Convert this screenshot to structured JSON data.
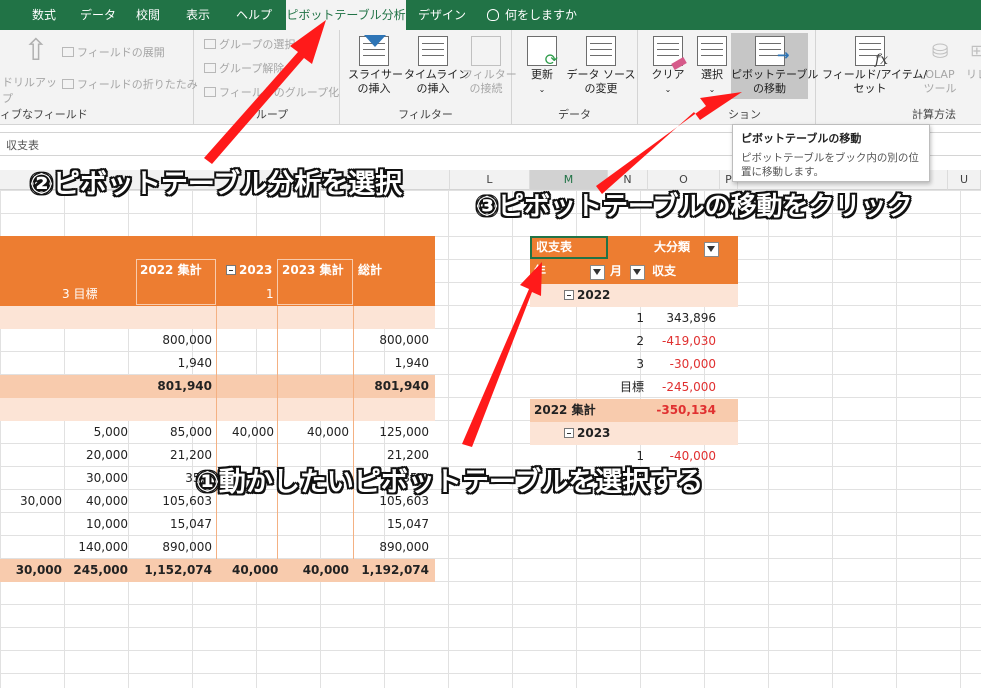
{
  "tabs": [
    "数式",
    "データ",
    "校閲",
    "表示",
    "ヘルプ",
    "ピボットテーブル分析",
    "デザイン",
    "何をしますか"
  ],
  "ribbon": {
    "group_field_label": "ィブなフィールド",
    "drillup_label": "ドリルアッ",
    "drillup_sub": "プ",
    "expand_label": "フィールドの展開",
    "collapse_label": "フィールドの折りたたみ",
    "group_sel": "グループの選択",
    "group_ungroup": "グループ解除",
    "group_field": "フィールドのグループ化",
    "group_label": "グループ",
    "slicer_label": "スライサー\nの挿入",
    "timeline_label": "タイムライン\nの挿入",
    "filter_conn_label": "フィルター\nの接続",
    "filter_group_label": "フィルター",
    "refresh_label": "更新",
    "change_source_label": "データ ソース\nの変更",
    "data_group_label": "データ",
    "clear_label": "クリア",
    "select_label": "選択",
    "move_label": "ピボットテーブル\nの移動",
    "action_group_label": "ション",
    "field_items_label": "フィールド/アイテム/\nセット",
    "olap_label": "OLAP\nツール",
    "rel_label": "リレ",
    "calc_group_label": "計算方法"
  },
  "formula_bar": {
    "value": "収支表"
  },
  "tooltip": {
    "title": "ピボットテーブルの移動",
    "body": "ピボットテーブルをブック内の別の位置に移動します。"
  },
  "columns": [
    "L",
    "M",
    "N",
    "O",
    "P",
    "U"
  ],
  "left_pivot": {
    "header_2022_total": "2022 集計",
    "header_2023": "2023",
    "header_2023_total": "2023 集計",
    "header_grand": "総計",
    "subhead_goal": "3 目標",
    "subhead_1": "1",
    "rows": [
      [
        "",
        "",
        "",
        "",
        "",
        "",
        ""
      ],
      [
        "",
        "",
        "800,000",
        "",
        "",
        "800,000"
      ],
      [
        "",
        "",
        "1,940",
        "",
        "",
        "1,940"
      ],
      [
        "",
        "",
        "801,940",
        "",
        "",
        "801,940"
      ],
      [
        "",
        "",
        "",
        "",
        "",
        ""
      ],
      [
        "",
        "5,000",
        "85,000",
        "40,000",
        "40,000",
        "125,000"
      ],
      [
        "",
        "20,000",
        "21,200",
        "",
        "",
        "21,200"
      ],
      [
        "",
        "30,000",
        "35,0",
        "",
        "",
        "35,0"
      ],
      [
        "30,000",
        "40,000",
        "105,603",
        "",
        "",
        "105,603"
      ],
      [
        "",
        "10,000",
        "15,047",
        "",
        "",
        "15,047"
      ],
      [
        "",
        "140,000",
        "890,000",
        "",
        "",
        "890,000"
      ],
      [
        "30,000",
        "245,000",
        "1,152,074",
        "40,000",
        "40,000",
        "1,192,074"
      ]
    ]
  },
  "right_pivot": {
    "title": "収支表",
    "col_field": "大分類",
    "row_field_1": "年",
    "row_field_2": "月",
    "value_field": "収支",
    "year_2022": "2022",
    "r1": [
      "1",
      "343,896"
    ],
    "r2": [
      "2",
      "-419,030"
    ],
    "r3": [
      "3",
      "-30,000"
    ],
    "r4": [
      "目標",
      "-245,000"
    ],
    "total_2022": [
      "2022 集計",
      "-350,134"
    ],
    "year_2023": "2023",
    "r5": [
      "1",
      "-40,000"
    ],
    "r6": [
      "目",
      ""
    ]
  },
  "annotations": {
    "step1": "①動かしたいピボットテーブルを選択する",
    "step2": "②ピボットテーブル分析を選択",
    "step3": "③ピボットテーブルの移動をクリック"
  },
  "colors": {
    "accent": "#217346",
    "arrow": "#ff1a1a",
    "pivot_header": "#ed7d31"
  }
}
